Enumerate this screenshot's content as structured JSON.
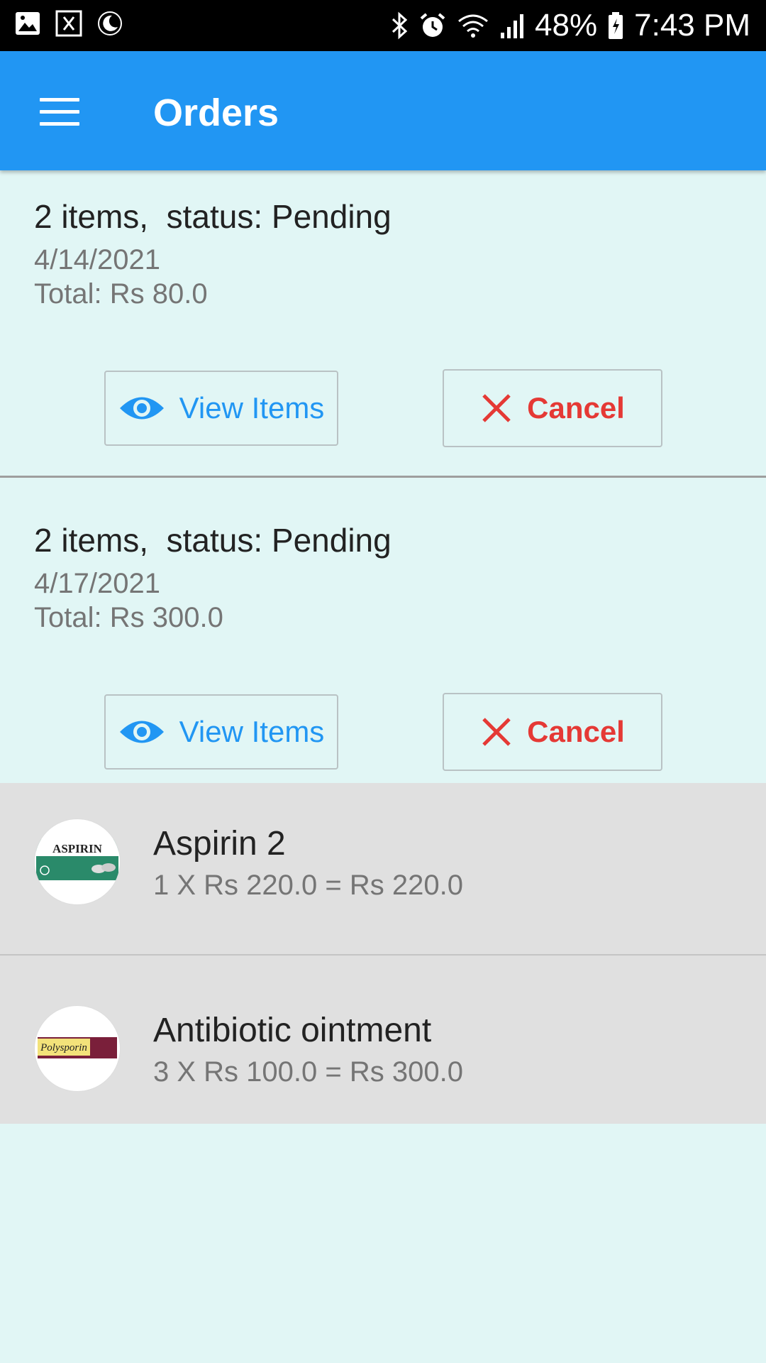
{
  "status_bar": {
    "battery": "48%",
    "time": "7:43 PM",
    "icons": [
      "gallery-icon",
      "notification-icon",
      "moon-icon",
      "bluetooth-icon",
      "alarm-icon",
      "wifi-icon",
      "signal-icon",
      "battery-icon"
    ]
  },
  "appbar": {
    "title": "Orders",
    "menu_icon": "hamburger-menu-icon"
  },
  "orders": [
    {
      "summary": "2 items,  status: Pending",
      "date": "4/14/2021",
      "total": "Total: Rs 80.0",
      "view_label": "View Items",
      "cancel_label": "Cancel"
    },
    {
      "summary": "2 items,  status: Pending",
      "date": "4/17/2021",
      "total": "Total: Rs 300.0",
      "view_label": "View Items",
      "cancel_label": "Cancel"
    }
  ],
  "items": [
    {
      "name": "Aspirin 2",
      "calc": "1 X Rs 220.0 = Rs 220.0",
      "thumb_text": "ASPIRIN"
    },
    {
      "name": "Antibiotic ointment",
      "calc": "3 X Rs 100.0 = Rs 300.0",
      "thumb_text": "Polysporin"
    }
  ],
  "colors": {
    "primary": "#2196f3",
    "danger": "#e53935",
    "background": "#e1f6f5"
  }
}
